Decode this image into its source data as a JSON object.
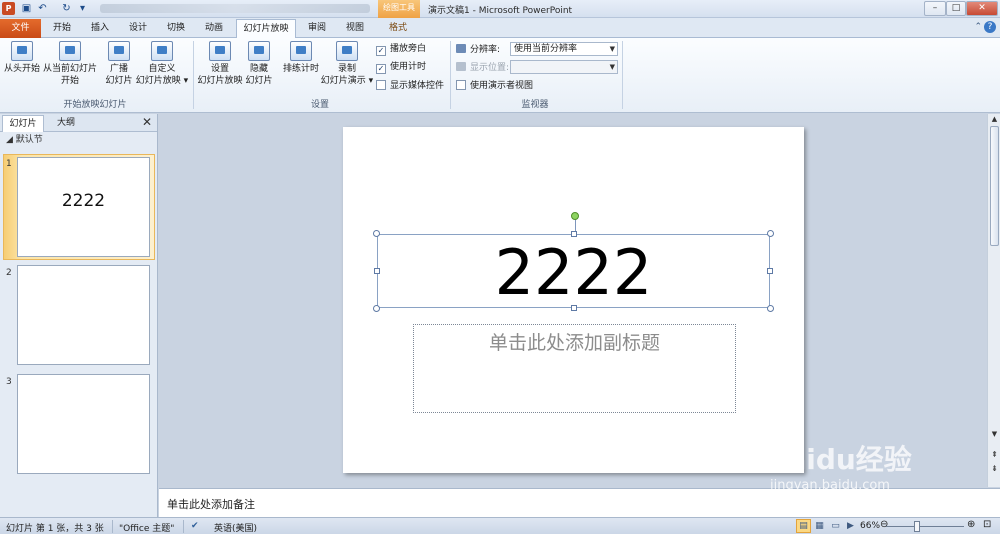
{
  "titlebar": {
    "app_icon": "P",
    "context_label": "绘图工具",
    "title": "演示文稿1 - Microsoft PowerPoint",
    "min": "–",
    "max": "□",
    "close": "✕"
  },
  "tabs": {
    "file": "文件",
    "items": [
      "开始",
      "插入",
      "设计",
      "切换",
      "动画",
      "幻灯片放映",
      "审阅",
      "视图",
      "格式"
    ]
  },
  "ribbon": {
    "start_group": {
      "from_beginning": "从头开始",
      "from_current_1": "从当前幻灯片",
      "from_current_2": "开始",
      "broadcast_1": "广播",
      "broadcast_2": "幻灯片",
      "custom_1": "自定义",
      "custom_2": "幻灯片放映 ▾",
      "label": "开始放映幻灯片"
    },
    "setup_group": {
      "setup_1": "设置",
      "setup_2": "幻灯片放映",
      "hide_1": "隐藏",
      "hide_2": "幻灯片",
      "rehearse": "排练计时",
      "record_1": "录制",
      "record_2": "幻灯片演示 ▾",
      "play_narration": "播放旁白",
      "use_timings": "使用计时",
      "show_media": "显示媒体控件",
      "label": "设置"
    },
    "monitors_group": {
      "resolution_label": "分辨率:",
      "resolution_value": "使用当前分辨率",
      "show_on_label": "显示位置:",
      "show_on_value": "",
      "presenter_view": "使用演示者视图",
      "label": "监视器"
    }
  },
  "left_panel": {
    "tab_slides": "幻灯片",
    "tab_outline": "大纲",
    "close": "✕",
    "section": "默认节",
    "slides": [
      {
        "number": "1",
        "text": "2222"
      },
      {
        "number": "2",
        "text": ""
      },
      {
        "number": "3",
        "text": ""
      }
    ]
  },
  "slide": {
    "title": "2222",
    "subtitle_placeholder": "单击此处添加副标题"
  },
  "notes": {
    "placeholder": "单击此处添加备注"
  },
  "statusbar": {
    "slide_info": "幻灯片 第 1 张，共 3 张",
    "theme": "\"Office 主题\"",
    "language": "英语(美国)",
    "zoom": "66%",
    "zoom_out": "⊖",
    "zoom_in": "⊕"
  },
  "watermark": {
    "logo": "Baidu经验",
    "sub": "jingyan.baidu.com"
  },
  "colors": {
    "file_tab": "#c94b17",
    "context_tab": "#efa244",
    "selected_thumb": "#f6cd74",
    "ribbon_bg": "#e8eff7"
  }
}
